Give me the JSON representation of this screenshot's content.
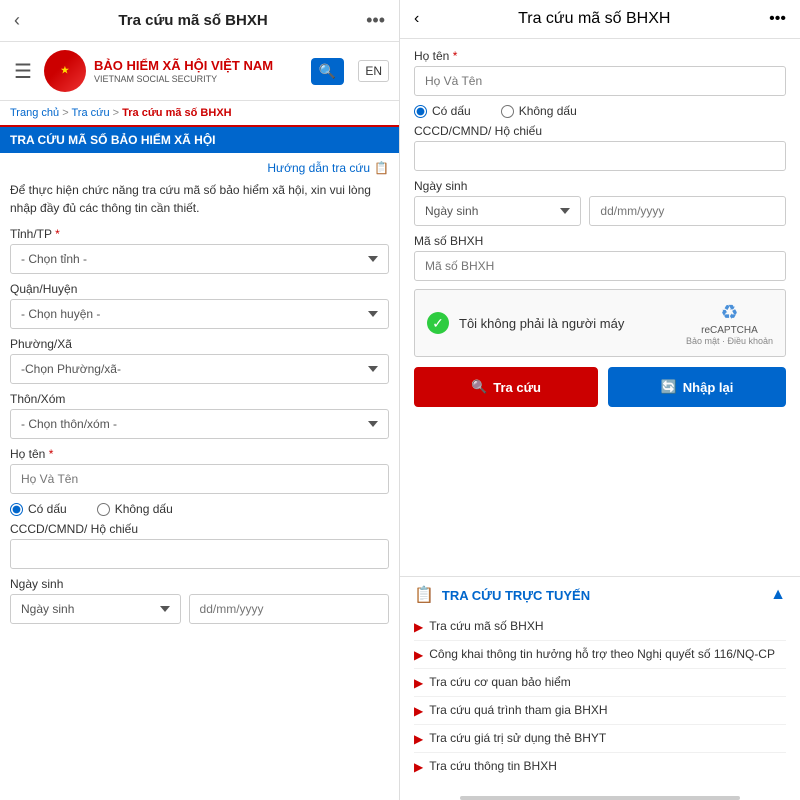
{
  "left": {
    "nav": {
      "back_icon": "‹",
      "title": "Tra cứu mã số BHXH",
      "dots_icon": "•••"
    },
    "header": {
      "hamburger_icon": "☰",
      "logo_text": "★",
      "logo_main": "BẢO HIỂM XÃ HỘI VIỆT NAM",
      "logo_sub": "VIETNAM SOCIAL SECURITY",
      "search_icon": "🔍",
      "lang": "EN"
    },
    "breadcrumb": {
      "home": "Trang chủ",
      "sep1": " > ",
      "parent": "Tra cứu",
      "sep2": " > ",
      "current": "Tra cứu mã số BHXH"
    },
    "section_title": "TRA CỨU MÃ SỐ BẢO HIỂM XÃ HỘI",
    "guide_link": "Hướng dẫn tra cứu",
    "description": "Để thực hiện chức năng tra cứu mã số bảo hiểm xã hội, xin vui lòng nhập đầy đủ các thông tin cần thiết.",
    "form": {
      "tinh_label": "Tỉnh/TP",
      "tinh_placeholder": "- Chọn tỉnh -",
      "quan_label": "Quận/Huyện",
      "quan_placeholder": "- Chọn huyện -",
      "phuong_label": "Phường/Xã",
      "phuong_placeholder": "-Chọn Phường/xã-",
      "thon_label": "Thôn/Xóm",
      "thon_placeholder": "- Chọn thôn/xóm -",
      "ho_ten_label": "Họ tên",
      "ho_ten_placeholder": "Họ Và Tên",
      "radio_co_dau": "Có dấu",
      "radio_khong_dau": "Không dấu",
      "cccd_label": "CCCD/CMND/ Hộ chiếu",
      "ngay_sinh_label": "Ngày sinh",
      "ngay_sinh_placeholder": "Ngày sinh",
      "date_placeholder": "dd/mm/yyyy"
    }
  },
  "right": {
    "nav": {
      "back_icon": "‹",
      "title": "Tra cứu mã số BHXH",
      "dots_icon": "•••"
    },
    "form": {
      "ho_ten_label": "Họ tên",
      "ho_ten_placeholder": "Họ Và Tên",
      "radio_co_dau": "Có dấu",
      "radio_khong_dau": "Không dấu",
      "cccd_label": "CCCD/CMND/ Hộ chiếu",
      "ngay_sinh_label": "Ngày sinh",
      "ngay_sinh_placeholder": "Ngày sinh",
      "date_placeholder": "dd/mm/yyyy",
      "ma_so_label": "Mã số BHXH",
      "ma_so_placeholder": "Mã số BHXH",
      "captcha_text": "Tôi không phải là người máy",
      "recaptcha_label": "reCAPTCHA",
      "recaptcha_sub": "Bảo mật · Điều khoản",
      "btn_search": "Tra cứu",
      "btn_reset": "Nhập lại"
    },
    "online_section": {
      "title": "TRA CỨU TRỰC TUYẾN",
      "items": [
        "Tra cứu mã số BHXH",
        "Công khai thông tin hưởng hỗ trợ theo Nghị quyết số 116/NQ-CP",
        "Tra cứu cơ quan bảo hiểm",
        "Tra cứu quá trình tham gia BHXH",
        "Tra cứu giá trị sử dụng thẻ BHYT",
        "Tra cứu thông tin BHXH"
      ]
    }
  }
}
